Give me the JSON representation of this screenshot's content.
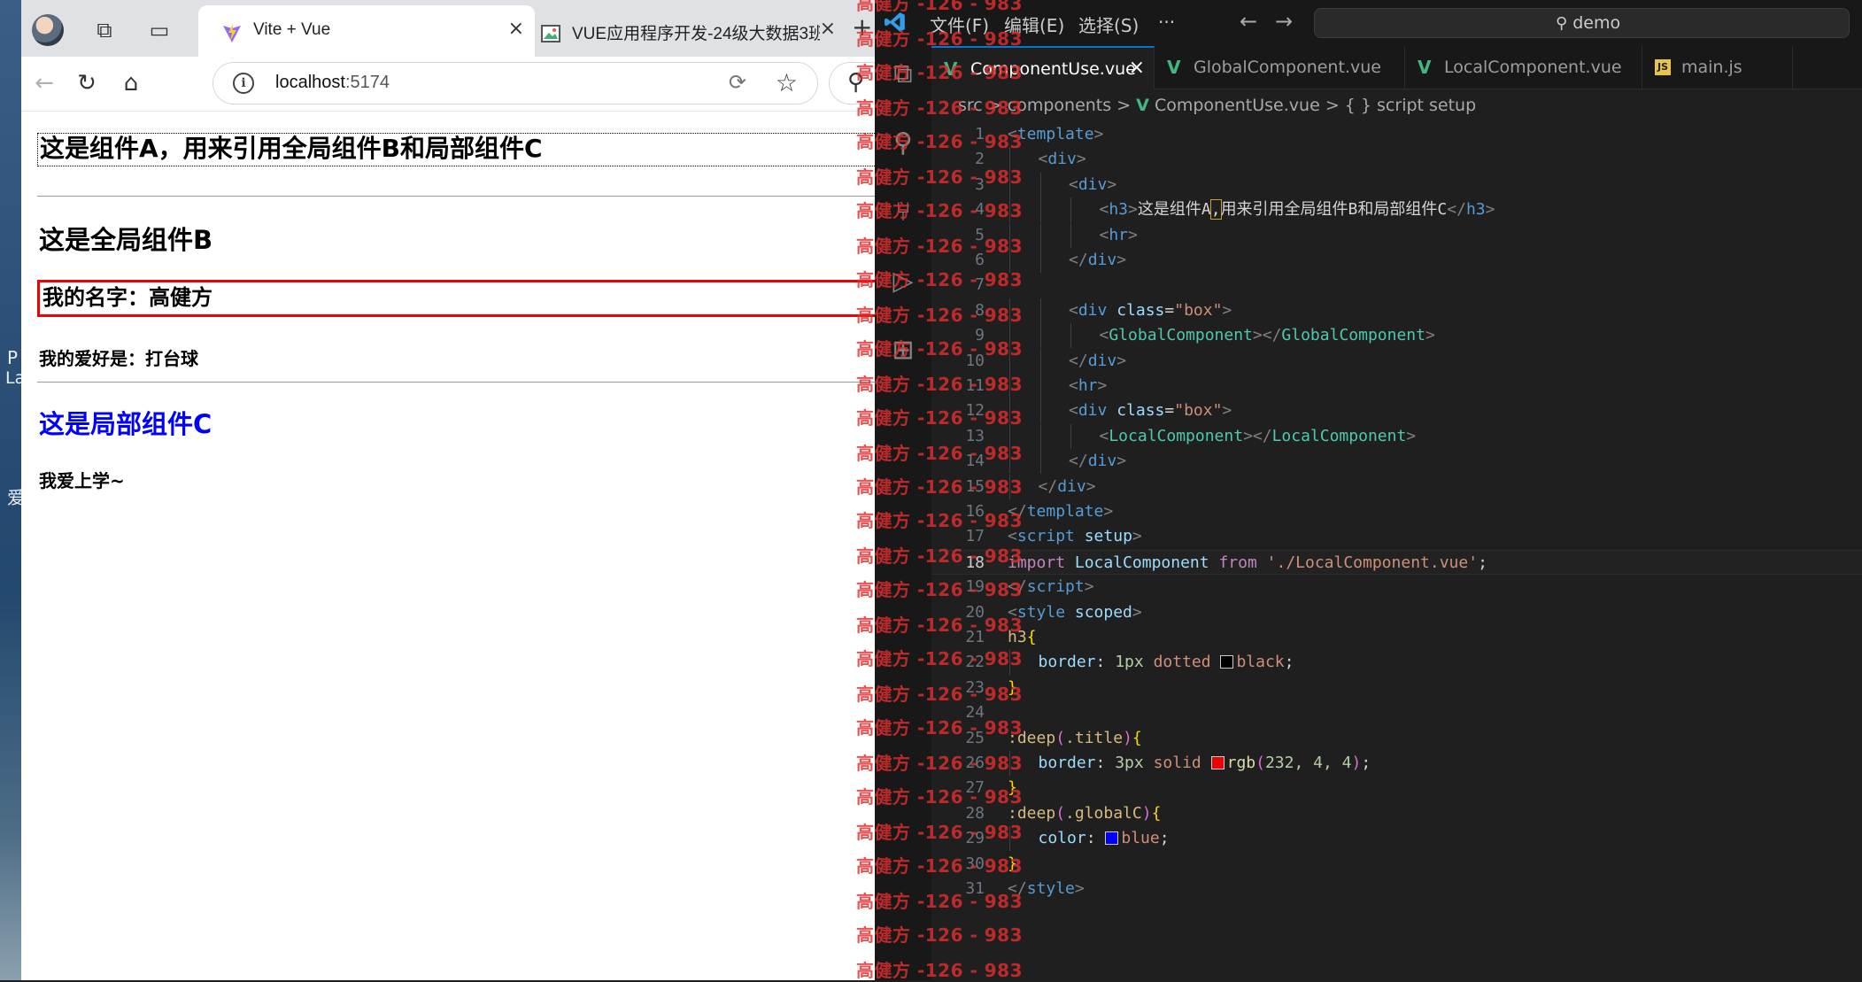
{
  "desktop": {
    "chars": [
      "P",
      "La",
      "爱"
    ]
  },
  "browser": {
    "tabs": [
      {
        "title": "Vite + Vue",
        "active": true
      },
      {
        "title": "VUE应用程序开发-24级大数据3班",
        "active": false
      }
    ],
    "close_glyph": "×",
    "new_tab_glyph": "+",
    "url_host": "localhost",
    "url_port": ":5174",
    "page": {
      "component_a_heading": "这是组件A，用来引用全局组件B和局部组件C",
      "global_b_heading": "这是全局组件B",
      "name_line": "我的名字：高健方",
      "hobby_line": "我的爱好是：打台球",
      "local_c_heading": "这是局部组件C",
      "local_c_text": "我爱上学~"
    }
  },
  "vscode": {
    "menu": [
      "文件(F)",
      "编辑(E)",
      "选择(S)",
      "···"
    ],
    "search_text": "demo",
    "editor_tabs": [
      {
        "label": "ComponentUse.vue",
        "type": "vue",
        "active": true
      },
      {
        "label": "GlobalComponent.vue",
        "type": "vue",
        "active": false
      },
      {
        "label": "LocalComponent.vue",
        "type": "vue",
        "active": false
      },
      {
        "label": "main.js",
        "type": "js",
        "active": false
      }
    ],
    "js_badge": "JS",
    "breadcrumbs": {
      "p1": "src",
      "p2": "components",
      "p3": "ComponentUse.vue",
      "p4": "{ } script setup",
      "sep": ">"
    },
    "current_line": 18,
    "code": {
      "l1": "template",
      "l2": "div",
      "l3": "div",
      "l4_tag": "h3",
      "l4_text_a": "这是组件A",
      "l4_comma": ",",
      "l4_text_b": "用来引用全局组件B和局部组件C",
      "l5": "hr",
      "l6": "div",
      "class_attr": "class",
      "box_value": "\"box\"",
      "l9_comp": "GlobalComponent",
      "l13_comp": "LocalComponent",
      "l17_tag": "script",
      "l17_attr": "setup",
      "l18_kw1": "import",
      "l18_id": "LocalComponent",
      "l18_kw2": "from",
      "l18_path": "'./LocalComponent.vue'",
      "l20_tag": "style",
      "l20_attr": "scoped",
      "l21_sel": "h3",
      "l22_prop": "border",
      "l22_num": "1px",
      "l22_v1": "dotted",
      "l22_color": "black",
      "l25_sel1": ":deep",
      "l25_sel2": ".title",
      "l26_prop": "border",
      "l26_num": "3px",
      "l26_v1": "solid",
      "l26_fn": "rgb",
      "l26_args": "232, 4, 4",
      "l28_sel1": ":deep",
      "l28_sel2": ".globalC",
      "l29_prop": "color",
      "l29_val": "blue"
    },
    "swatch_colors": {
      "black": "#000000",
      "red": "#e80404",
      "blue": "#0000ff"
    }
  },
  "watermark": {
    "text": "高健方 -126 - 983"
  }
}
